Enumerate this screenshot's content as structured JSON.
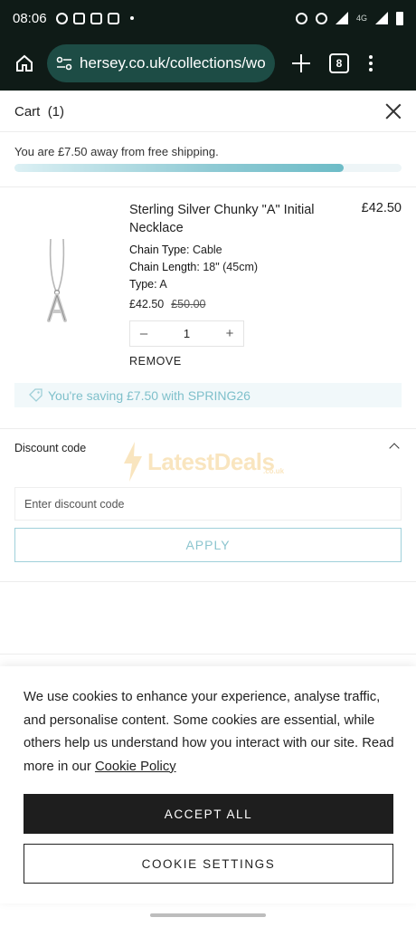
{
  "status_bar": {
    "time": "08:06",
    "network": "4G"
  },
  "browser": {
    "url": "hersey.co.uk/collections/wo",
    "tab_count": "8"
  },
  "cart": {
    "title": "Cart",
    "count": "(1)",
    "shipping_message": "You are £7.50 away from free shipping.",
    "shipping_progress": 0.85
  },
  "item": {
    "name": "Sterling Silver Chunky \"A\" Initial Necklace",
    "line_price": "£42.50",
    "attributes": [
      {
        "label": "Chain Type:",
        "value": "Cable"
      },
      {
        "label": "Chain Length:",
        "value": "18\" (45cm)"
      },
      {
        "label": "Type:",
        "value": "A"
      }
    ],
    "price": "£42.50",
    "compare_price": "£50.00",
    "quantity": "1",
    "remove_label": "REMOVE"
  },
  "saving_message": "You're saving £7.50 with SPRING26",
  "discount": {
    "heading": "Discount code",
    "placeholder": "Enter discount code",
    "apply_label": "APPLY"
  },
  "watermark": {
    "text": "LatestDeals",
    "sub": ".co.uk"
  },
  "cookie": {
    "text": "We use cookies to enhance your experience, analyse traffic, and personalise content. Some cookies are essential, while others help us understand how you interact with our site. Read more in our",
    "link_label": "Cookie Policy",
    "accept_label": "ACCEPT ALL",
    "settings_label": "COOKIE SETTINGS"
  },
  "colors": {
    "accent": "#8cc5cf",
    "browser_bg": "#0f1b17",
    "url_pill": "#1d4c45"
  }
}
